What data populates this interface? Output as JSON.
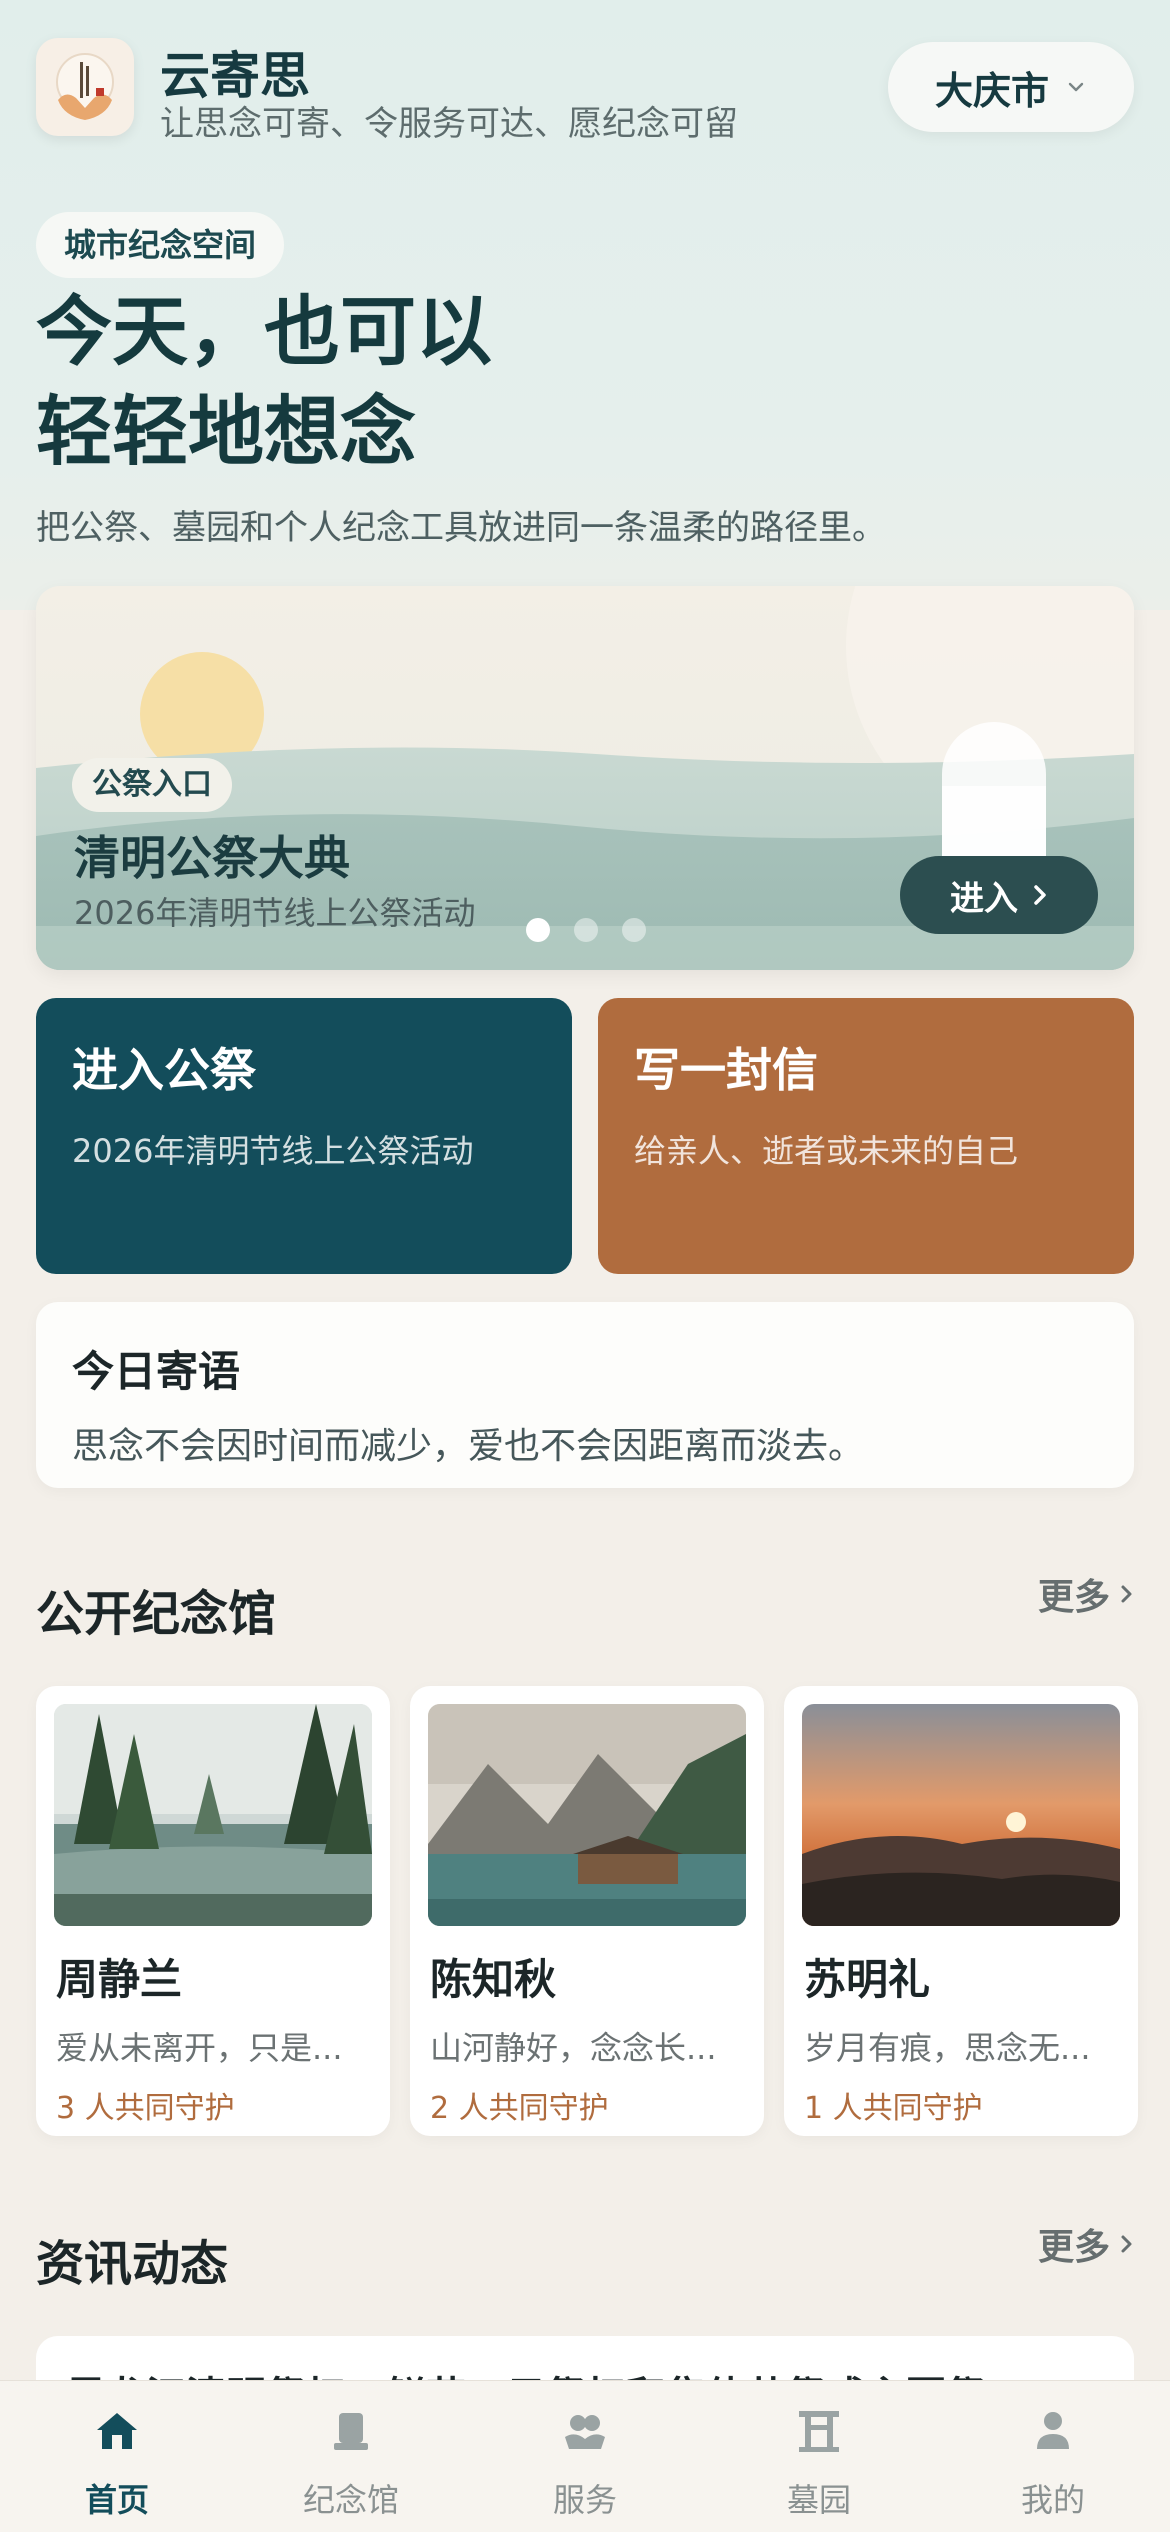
{
  "header": {
    "app_name": "云寄思",
    "slogan": "让思念可寄、令服务可达、愿纪念可留",
    "city": "大庆市"
  },
  "hero": {
    "tag": "城市纪念空间",
    "title_line1": "今天，也可以",
    "title_line2": "轻轻地想念",
    "subtitle": "把公祭、墓园和个人纪念工具放进同一条温柔的路径里。"
  },
  "banner": {
    "tag": "公祭入口",
    "title": "清明公祭大典",
    "subtitle": "2026年清明节线上公祭活动",
    "button": "进入",
    "slide_count": 3,
    "active_slide": 1
  },
  "actions": [
    {
      "title": "进入公祭",
      "subtitle": "2026年清明节线上公祭活动",
      "color": "#134d5b"
    },
    {
      "title": "写一封信",
      "subtitle": "给亲人、逝者或未来的自己",
      "color": "#b06c3e"
    }
  ],
  "quote": {
    "title": "今日寄语",
    "text": "思念不会因时间而减少，爱也不会因距离而淡去。"
  },
  "memorials": {
    "title": "公开纪念馆",
    "more": "更多",
    "items": [
      {
        "name": "周静兰",
        "desc": "爱从未离开，只是...",
        "guard": "3 人共同守护"
      },
      {
        "name": "陈知秋",
        "desc": "山河静好，念念长...",
        "guard": "2 人共同守护"
      },
      {
        "name": "苏明礼",
        "desc": "岁月有痕，思念无...",
        "guard": "1 人共同守护"
      }
    ]
  },
  "news": {
    "title": "资讯动态",
    "more": "更多",
    "first_item": "黑龙江清明祭扫：鲜花、云祭扫和集体共祭成主要祭"
  },
  "tabbar": [
    {
      "label": "首页",
      "icon": "home-icon",
      "active": true
    },
    {
      "label": "纪念馆",
      "icon": "memorial-hall-icon",
      "active": false
    },
    {
      "label": "服务",
      "icon": "service-icon",
      "active": false
    },
    {
      "label": "墓园",
      "icon": "cemetery-icon",
      "active": false
    },
    {
      "label": "我的",
      "icon": "profile-icon",
      "active": false
    }
  ],
  "colors": {
    "teal": "#134d5b",
    "orange": "#b06c3e",
    "background": "#f3efe9"
  }
}
